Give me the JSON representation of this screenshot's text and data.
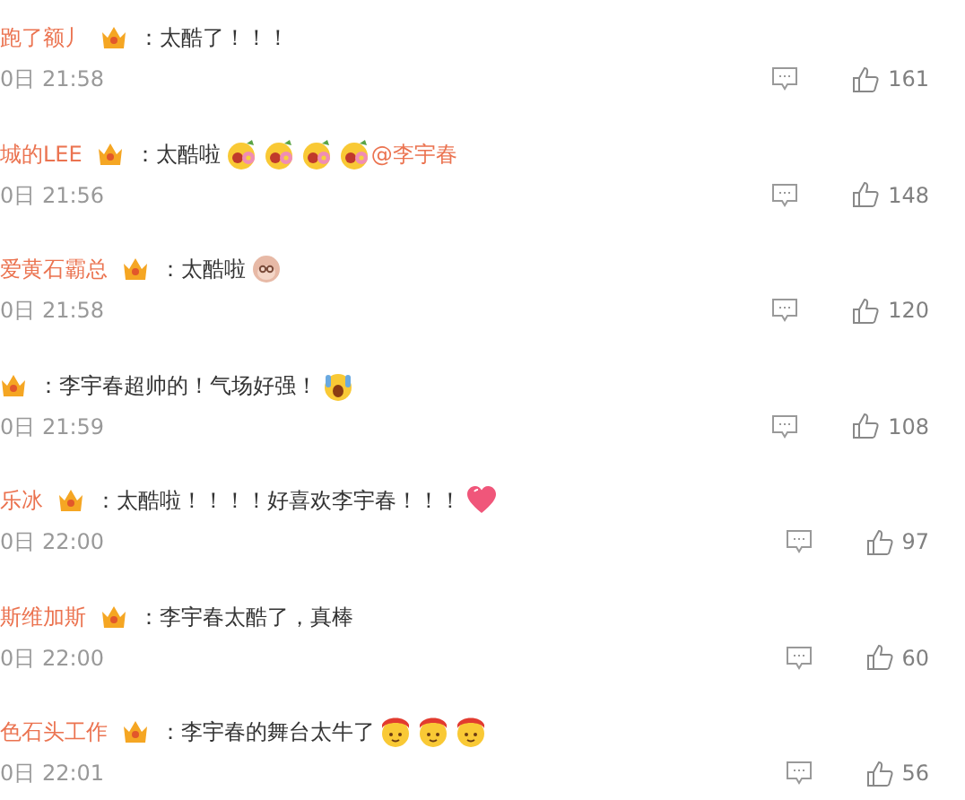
{
  "comments": [
    {
      "username": "跑了额丿",
      "text": "：太酷了！！！",
      "time": "0日 21:58",
      "likes": "161"
    },
    {
      "username": "城的LEE",
      "text": "：太酷啦",
      "stickers": [
        {
          "kind": "flower"
        },
        {
          "kind": "flower"
        },
        {
          "kind": "flower"
        },
        {
          "kind": "flower"
        }
      ],
      "mention": "@李宇春",
      "time": "0日 21:56",
      "likes": "148"
    },
    {
      "username": "爱黄石霸总",
      "text": "：太酷啦",
      "stickers": [
        {
          "kind": "monkey"
        }
      ],
      "time": "0日 21:58",
      "likes": "120"
    },
    {
      "text": "：李宇春超帅的！气场好强！",
      "stickers": [
        {
          "kind": "shocked"
        }
      ],
      "time": "0日 21:59",
      "likes": "108"
    },
    {
      "username": "乐冰",
      "text": "：太酷啦！！！！好喜欢李宇春！！！",
      "stickers": [
        {
          "kind": "heart"
        }
      ],
      "time": "0日 22:00",
      "likes": "97"
    },
    {
      "username": "斯维加斯",
      "text": "：李宇春太酷了，真棒",
      "time": "0日 22:00",
      "likes": "60"
    },
    {
      "username": "色石头工作",
      "text": "：李宇春的舞台太牛了",
      "stickers": [
        {
          "kind": "bandana"
        },
        {
          "kind": "bandana"
        },
        {
          "kind": "bandana"
        }
      ],
      "time": "0日 22:01",
      "likes": "56"
    }
  ]
}
